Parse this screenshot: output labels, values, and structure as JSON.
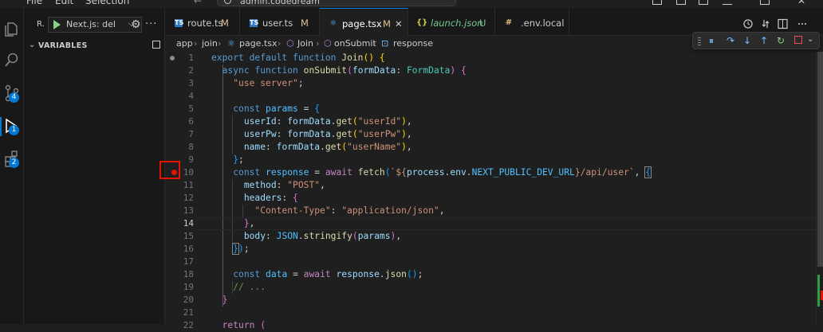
{
  "menubar": {
    "items": [
      "File",
      "Edit",
      "Selection"
    ]
  },
  "command_center": {
    "text": "admin.codedream"
  },
  "activity_badges": {
    "source_control": "4",
    "run_debug": "1",
    "extensions": "2"
  },
  "sidebar": {
    "run_prefix": "R.",
    "launch_config": "Next.js: del",
    "section_title": "VARIABLES"
  },
  "tabs": [
    {
      "name": "route.ts",
      "modified": "M",
      "icon": "TS"
    },
    {
      "name": "user.ts",
      "modified": "M",
      "icon": "TS"
    },
    {
      "name": "page.tsx",
      "modified": "M",
      "icon": "tsx",
      "active": true
    },
    {
      "name": "launch.json",
      "modified": "U",
      "icon": "{}"
    },
    {
      "name": ".env.local",
      "modified": "",
      "icon": "#"
    }
  ],
  "breadcrumb": [
    "app",
    "join",
    "page.tsx",
    "Join",
    "onSubmit",
    "response"
  ],
  "editor": {
    "current_line": 14,
    "breakpoint_line": 10,
    "line_numbers": [
      "1",
      "2",
      "3",
      "4",
      "5",
      "6",
      "7",
      "8",
      "9",
      "10",
      "11",
      "12",
      "13",
      "14",
      "15",
      "16",
      "17",
      "18",
      "19",
      "20",
      "21",
      "22"
    ]
  },
  "colors": {
    "accent": "#0078d4",
    "breakpoint": "#e51400",
    "continue": "#89d185",
    "stop": "#f14c4c"
  }
}
